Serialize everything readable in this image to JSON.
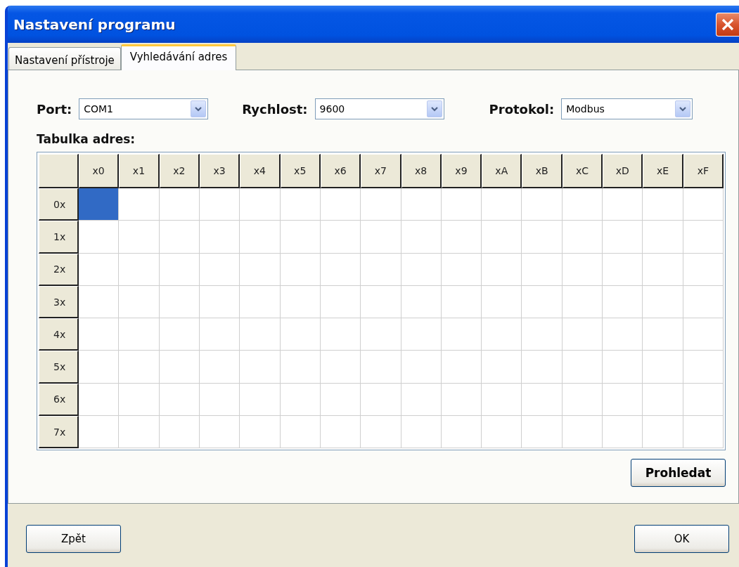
{
  "window": {
    "title": "Nastavení programu"
  },
  "tabs": [
    {
      "label": "Nastavení přístroje",
      "selected": false
    },
    {
      "label": "Vyhledávání adres",
      "selected": true
    }
  ],
  "settings": [
    {
      "label": "Port:",
      "value": "COM1"
    },
    {
      "label": "Rychlost:",
      "value": "9600"
    },
    {
      "label": "Protokol:",
      "value": "Modbus"
    }
  ],
  "table": {
    "title": "Tabulka adres:",
    "columns": [
      "x0",
      "x1",
      "x2",
      "x3",
      "x4",
      "x5",
      "x6",
      "x7",
      "x8",
      "x9",
      "xA",
      "xB",
      "xC",
      "xD",
      "xE",
      "xF"
    ],
    "rows": [
      {
        "label": "0x",
        "cells": [
          {
            "selected": true
          },
          {
            "selected": false
          },
          {
            "selected": false
          },
          {
            "selected": false
          },
          {
            "selected": false
          },
          {
            "selected": false
          },
          {
            "selected": false
          },
          {
            "selected": false
          },
          {
            "selected": false
          },
          {
            "selected": false
          },
          {
            "selected": false
          },
          {
            "selected": false
          },
          {
            "selected": false
          },
          {
            "selected": false
          },
          {
            "selected": false
          },
          {
            "selected": false
          }
        ]
      },
      {
        "label": "1x",
        "cells": [
          {
            "selected": false
          },
          {
            "selected": false
          },
          {
            "selected": false
          },
          {
            "selected": false
          },
          {
            "selected": false
          },
          {
            "selected": false
          },
          {
            "selected": false
          },
          {
            "selected": false
          },
          {
            "selected": false
          },
          {
            "selected": false
          },
          {
            "selected": false
          },
          {
            "selected": false
          },
          {
            "selected": false
          },
          {
            "selected": false
          },
          {
            "selected": false
          },
          {
            "selected": false
          }
        ]
      },
      {
        "label": "2x",
        "cells": [
          {
            "selected": false
          },
          {
            "selected": false
          },
          {
            "selected": false
          },
          {
            "selected": false
          },
          {
            "selected": false
          },
          {
            "selected": false
          },
          {
            "selected": false
          },
          {
            "selected": false
          },
          {
            "selected": false
          },
          {
            "selected": false
          },
          {
            "selected": false
          },
          {
            "selected": false
          },
          {
            "selected": false
          },
          {
            "selected": false
          },
          {
            "selected": false
          },
          {
            "selected": false
          }
        ]
      },
      {
        "label": "3x",
        "cells": [
          {
            "selected": false
          },
          {
            "selected": false
          },
          {
            "selected": false
          },
          {
            "selected": false
          },
          {
            "selected": false
          },
          {
            "selected": false
          },
          {
            "selected": false
          },
          {
            "selected": false
          },
          {
            "selected": false
          },
          {
            "selected": false
          },
          {
            "selected": false
          },
          {
            "selected": false
          },
          {
            "selected": false
          },
          {
            "selected": false
          },
          {
            "selected": false
          },
          {
            "selected": false
          }
        ]
      },
      {
        "label": "4x",
        "cells": [
          {
            "selected": false
          },
          {
            "selected": false
          },
          {
            "selected": false
          },
          {
            "selected": false
          },
          {
            "selected": false
          },
          {
            "selected": false
          },
          {
            "selected": false
          },
          {
            "selected": false
          },
          {
            "selected": false
          },
          {
            "selected": false
          },
          {
            "selected": false
          },
          {
            "selected": false
          },
          {
            "selected": false
          },
          {
            "selected": false
          },
          {
            "selected": false
          },
          {
            "selected": false
          }
        ]
      },
      {
        "label": "5x",
        "cells": [
          {
            "selected": false
          },
          {
            "selected": false
          },
          {
            "selected": false
          },
          {
            "selected": false
          },
          {
            "selected": false
          },
          {
            "selected": false
          },
          {
            "selected": false
          },
          {
            "selected": false
          },
          {
            "selected": false
          },
          {
            "selected": false
          },
          {
            "selected": false
          },
          {
            "selected": false
          },
          {
            "selected": false
          },
          {
            "selected": false
          },
          {
            "selected": false
          },
          {
            "selected": false
          }
        ]
      },
      {
        "label": "6x",
        "cells": [
          {
            "selected": false
          },
          {
            "selected": false
          },
          {
            "selected": false
          },
          {
            "selected": false
          },
          {
            "selected": false
          },
          {
            "selected": false
          },
          {
            "selected": false
          },
          {
            "selected": false
          },
          {
            "selected": false
          },
          {
            "selected": false
          },
          {
            "selected": false
          },
          {
            "selected": false
          },
          {
            "selected": false
          },
          {
            "selected": false
          },
          {
            "selected": false
          },
          {
            "selected": false
          }
        ]
      },
      {
        "label": "7x",
        "cells": [
          {
            "selected": false
          },
          {
            "selected": false
          },
          {
            "selected": false
          },
          {
            "selected": false
          },
          {
            "selected": false
          },
          {
            "selected": false
          },
          {
            "selected": false
          },
          {
            "selected": false
          },
          {
            "selected": false
          },
          {
            "selected": false
          },
          {
            "selected": false
          },
          {
            "selected": false
          },
          {
            "selected": false
          },
          {
            "selected": false
          },
          {
            "selected": false
          },
          {
            "selected": false
          }
        ]
      }
    ]
  },
  "search_button": "Prohledat",
  "buttons": [
    "Zpět",
    "OK"
  ]
}
